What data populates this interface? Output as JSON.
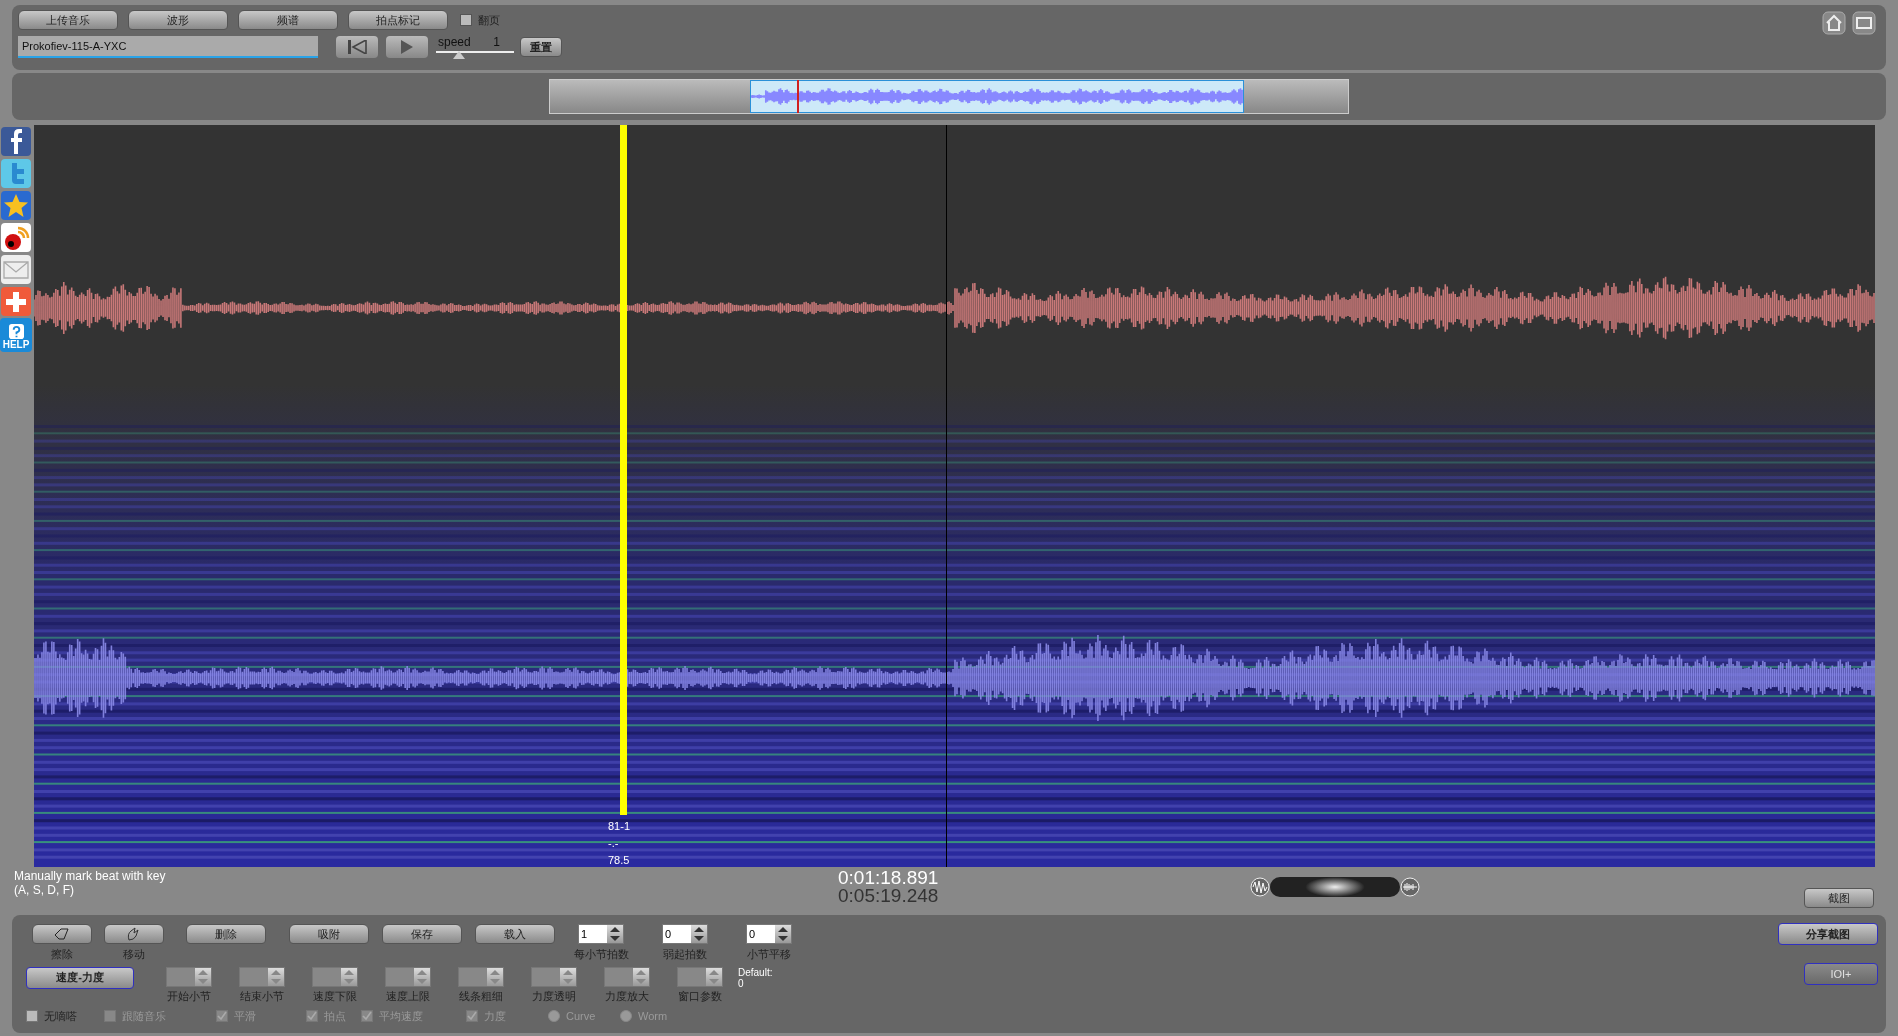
{
  "top_buttons": [
    "上传音乐",
    "波形",
    "频谱",
    "拍点标记"
  ],
  "page_flip": {
    "label": "翻页",
    "checked": false
  },
  "file_name": {
    "value": "Prokofiev-115-A-YXC"
  },
  "speed": {
    "label": "speed",
    "value": "1",
    "level": 0.3
  },
  "reset_button": "重置",
  "zoom": {
    "level": 0.5
  },
  "help_label": "HELP",
  "cursor_labels": [
    "81-1",
    "-.-",
    "78.5"
  ],
  "hint": [
    "Manually mark beat with key",
    "(A, S, D, F)"
  ],
  "time": {
    "current": "0:01:18.891",
    "total": "0:05:19.248"
  },
  "screenshot_button": "截图",
  "tools": [
    {
      "kind": "eraser",
      "label": "擦除"
    },
    {
      "kind": "hand",
      "label": "移动"
    },
    {
      "kind": "text",
      "label": "删除"
    },
    {
      "kind": "text",
      "label": "吸附"
    },
    {
      "kind": "text",
      "label": "保存"
    },
    {
      "kind": "text",
      "label": "载入"
    }
  ],
  "spinners": [
    {
      "label": "每小节拍数",
      "value": "1"
    },
    {
      "label": "弱起拍数",
      "value": "0"
    },
    {
      "label": "小节平移",
      "value": "0"
    }
  ],
  "mode_button": "速度-力度",
  "disabled_spinners": [
    "开始小节",
    "结束小节",
    "速度下限",
    "速度上限",
    "线条粗细",
    "力度透明",
    "力度放大",
    "窗口参数"
  ],
  "default_note": [
    "Default:",
    "0"
  ],
  "options": [
    {
      "kind": "checkbox",
      "label": "无嘀嗒",
      "checked": false,
      "disabled": false
    },
    {
      "kind": "checkbox",
      "label": "跟随音乐",
      "checked": false,
      "disabled": true
    },
    {
      "kind": "checkbox",
      "label": "平滑",
      "checked": true,
      "disabled": true
    },
    {
      "kind": "checkbox",
      "label": "拍点",
      "checked": true,
      "disabled": true
    },
    {
      "kind": "checkbox",
      "label": "平均速度",
      "checked": true,
      "disabled": true
    },
    {
      "kind": "checkbox",
      "label": "力度",
      "checked": true,
      "disabled": true
    },
    {
      "kind": "radio",
      "label": "Curve",
      "selected": false,
      "disabled": true
    },
    {
      "kind": "radio",
      "label": "Worm",
      "selected": false,
      "disabled": true
    }
  ],
  "share_button": "分享截图",
  "ioi_button": {
    "label": "IOI+",
    "disabled": true
  }
}
